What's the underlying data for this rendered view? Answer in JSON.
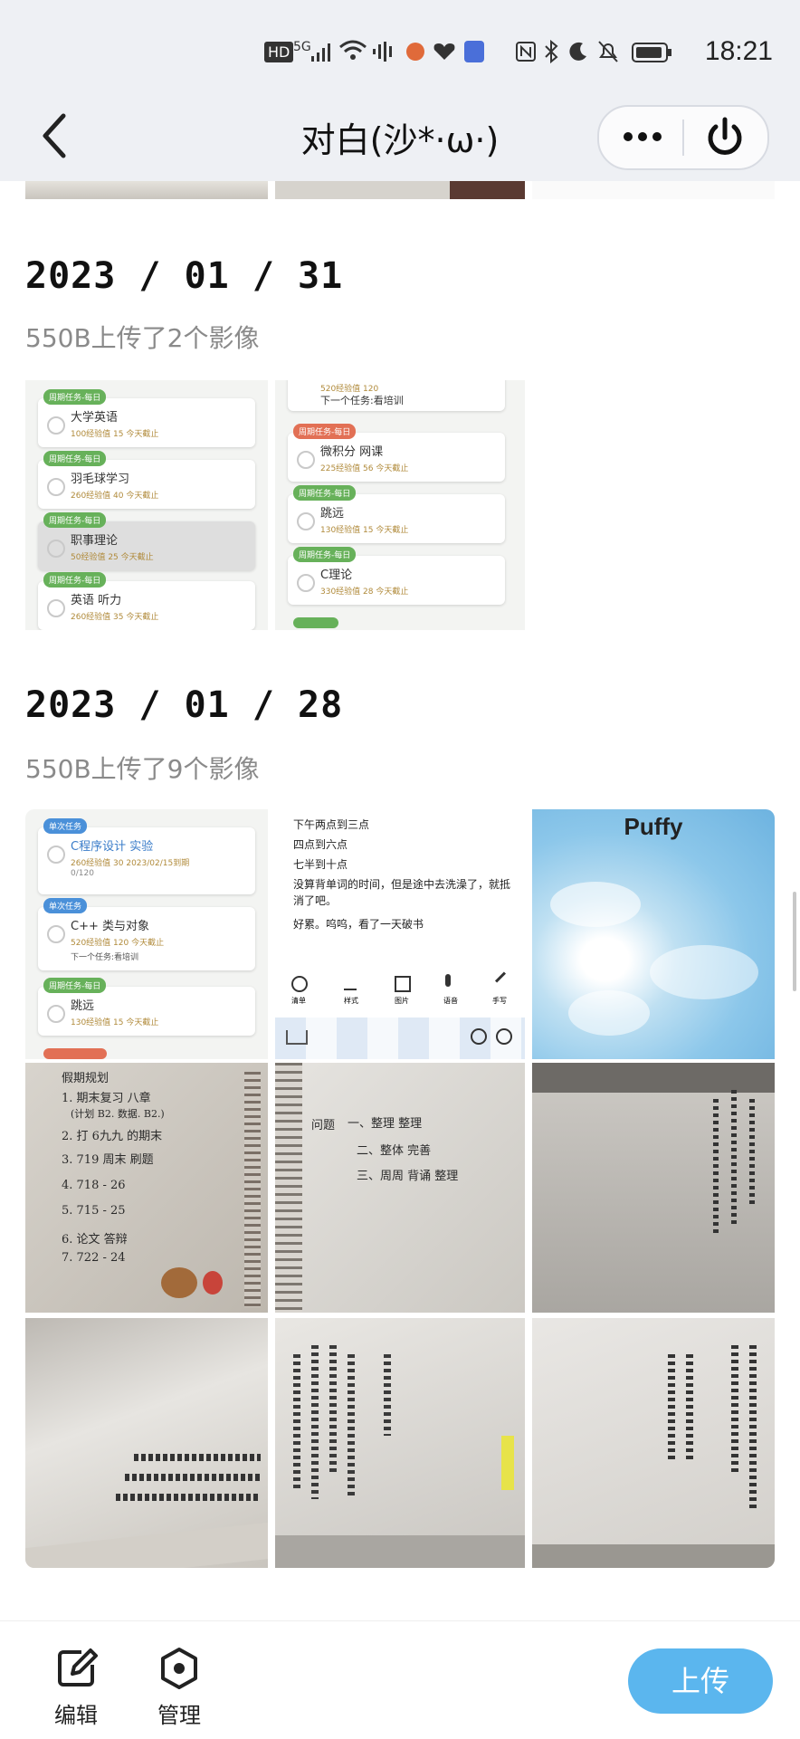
{
  "status_bar": {
    "hd": "HD",
    "signal": "5G",
    "time": "18:21"
  },
  "header": {
    "title": "对白(沙*·ω·)"
  },
  "sections": [
    {
      "date": "2023 / 01 / 31",
      "summary": "550B上传了2个影像",
      "photo_a_cards": [
        {
          "tag": "周期任务-每日",
          "title": "大学英语",
          "sub": "100经验值 15 今天截止"
        },
        {
          "tag": "周期任务-每日",
          "title": "羽毛球学习",
          "sub": "260经验值 40 今天截止"
        },
        {
          "tag": "周期任务-每日",
          "title": "职事理论",
          "sub": "50经验值 25 今天截止"
        },
        {
          "tag": "周期任务-每日",
          "title": "英语 听力",
          "sub": "260经验值 35 今天截止"
        }
      ],
      "photo_b_cards": [
        {
          "tag": "",
          "title": "下一个任务:看培训",
          "sub": "520经验值 120"
        },
        {
          "tag": "周期任务-每日",
          "title": "微积分 网课",
          "sub": "225经验值 56 今天截止"
        },
        {
          "tag": "周期任务-每日",
          "title": "跳远",
          "sub": "130经验值 15 今天截止"
        },
        {
          "tag": "周期任务-每日",
          "title": "C理论",
          "sub": "330经验值 28 今天截止"
        }
      ]
    },
    {
      "date": "2023 / 01 / 28",
      "summary": "550B上传了9个影像",
      "photo1_cards": [
        {
          "tag": "单次任务",
          "title": "C程序设计 实验",
          "sub": "260经验值 30 2023/02/15到期"
        },
        {
          "tag": "单次任务",
          "title": "C++ 类与对象",
          "sub": "520经验值 120 今天截止"
        },
        {
          "tag": "周期任务-每日",
          "title": "跳远",
          "sub": "130经验值 15 今天截止"
        }
      ],
      "photo1_extra": [
        "0/120",
        "下一个任务:看培训"
      ],
      "notes_lines": [
        "下午两点到三点",
        "四点到六点",
        "七半到十点",
        "没算背单词的时间，但是途中去洗澡了，就抵消了吧。",
        "好累。呜呜，看了一天破书"
      ],
      "notes_tools": [
        "清单",
        "样式",
        "图片",
        "语音",
        "手写"
      ],
      "puffy_title": "Puffy",
      "hand4_lines": [
        "假期规划",
        "1. 期末复习 八章",
        "(计划 B2. 数据. B2.)",
        "2. 打 6九九 的期末",
        "3. 719 周末 刷题",
        "4. 718 - 26",
        "5. 715 - 25",
        "6. 论文 答辩",
        "7. 722 - 24"
      ],
      "hand5_lines": [
        "一、整理 整理",
        "二、整体 完善",
        "三、周周 背诵 整理",
        "问题"
      ]
    }
  ],
  "bottom_bar": {
    "edit_label": "编辑",
    "manage_label": "管理",
    "upload_label": "上传"
  }
}
